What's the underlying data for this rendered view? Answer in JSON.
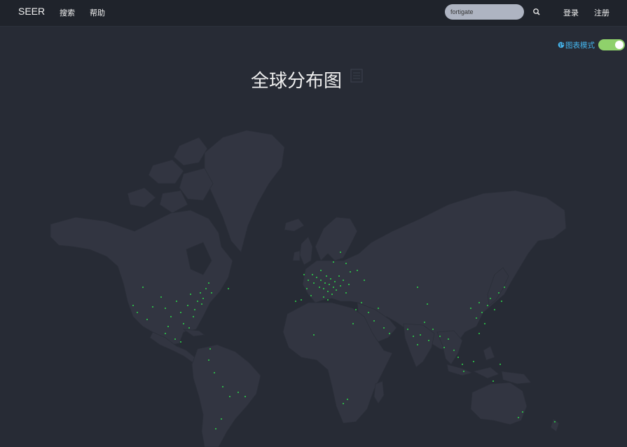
{
  "navbar": {
    "brand": "SEER",
    "links": [
      "搜索",
      "帮助"
    ],
    "search": {
      "value": "fortigate"
    },
    "auth": {
      "login": "登录",
      "register": "注册"
    }
  },
  "toggle": {
    "label": "图表模式",
    "on": true
  },
  "title": "全球分布图",
  "colors": {
    "background": "#272b35",
    "land": "#323541",
    "dots": "#2dd84a",
    "toggle_on": "#8fd16b",
    "toggle_label": "#45b7f0"
  }
}
